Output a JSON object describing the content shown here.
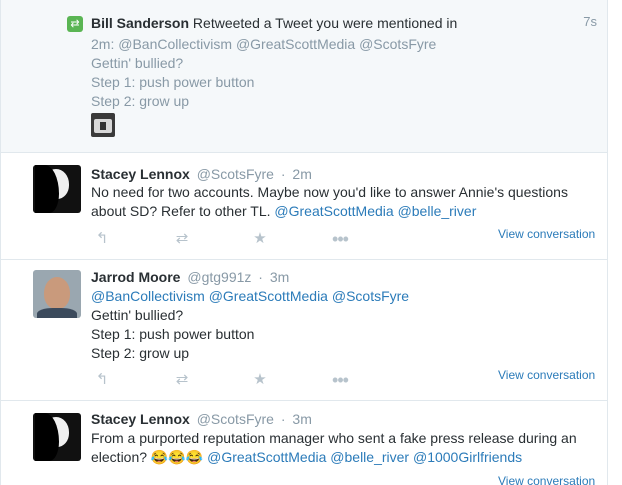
{
  "notification": {
    "actor": "Bill Sanderson",
    "action_text": "Retweeted a Tweet you were mentioned in",
    "time": "7s",
    "quoted_prefix": "2m:",
    "quoted_mentions": [
      "@BanCollectivism",
      "@GreatScottMedia",
      "@ScotsFyre"
    ],
    "quoted_lines": [
      "Gettin' bullied?",
      "Step 1: push power button",
      "Step 2: grow up"
    ],
    "icon": "retweet-icon"
  },
  "tweets": [
    {
      "name": "Stacey Lennox",
      "handle": "@ScotsFyre",
      "dot": "·",
      "time": "2m",
      "line1": "No need for two accounts. Maybe now you'd like to answer Annie's questions",
      "line2_text": "about SD? Refer to other TL. ",
      "line2_mentions": [
        "@GreatScottMedia",
        "@belle_river"
      ],
      "view_conversation": "View conversation"
    },
    {
      "name": "Jarrod Moore",
      "handle": "@gtg991z",
      "dot": "·",
      "time": "3m",
      "mentions": [
        "@BanCollectivism",
        "@GreatScottMedia",
        "@ScotsFyre"
      ],
      "lines": [
        "Gettin' bullied?",
        "Step 1: push power button",
        "Step 2: grow up"
      ],
      "view_conversation": "View conversation"
    },
    {
      "name": "Stacey Lennox",
      "handle": "@ScotsFyre",
      "dot": "·",
      "time": "3m",
      "line1": "From a purported reputation manager who sent a fake press release during an",
      "line2_text": "election? 😂😂😂 ",
      "line2_mentions": [
        "@GreatScottMedia",
        "@belle_river",
        "@1000Girlfriends"
      ],
      "view_conversation": "View conversation"
    }
  ],
  "action_icons": {
    "reply": "↰",
    "retweet": "⇄",
    "favorite": "★",
    "more": "•••"
  }
}
